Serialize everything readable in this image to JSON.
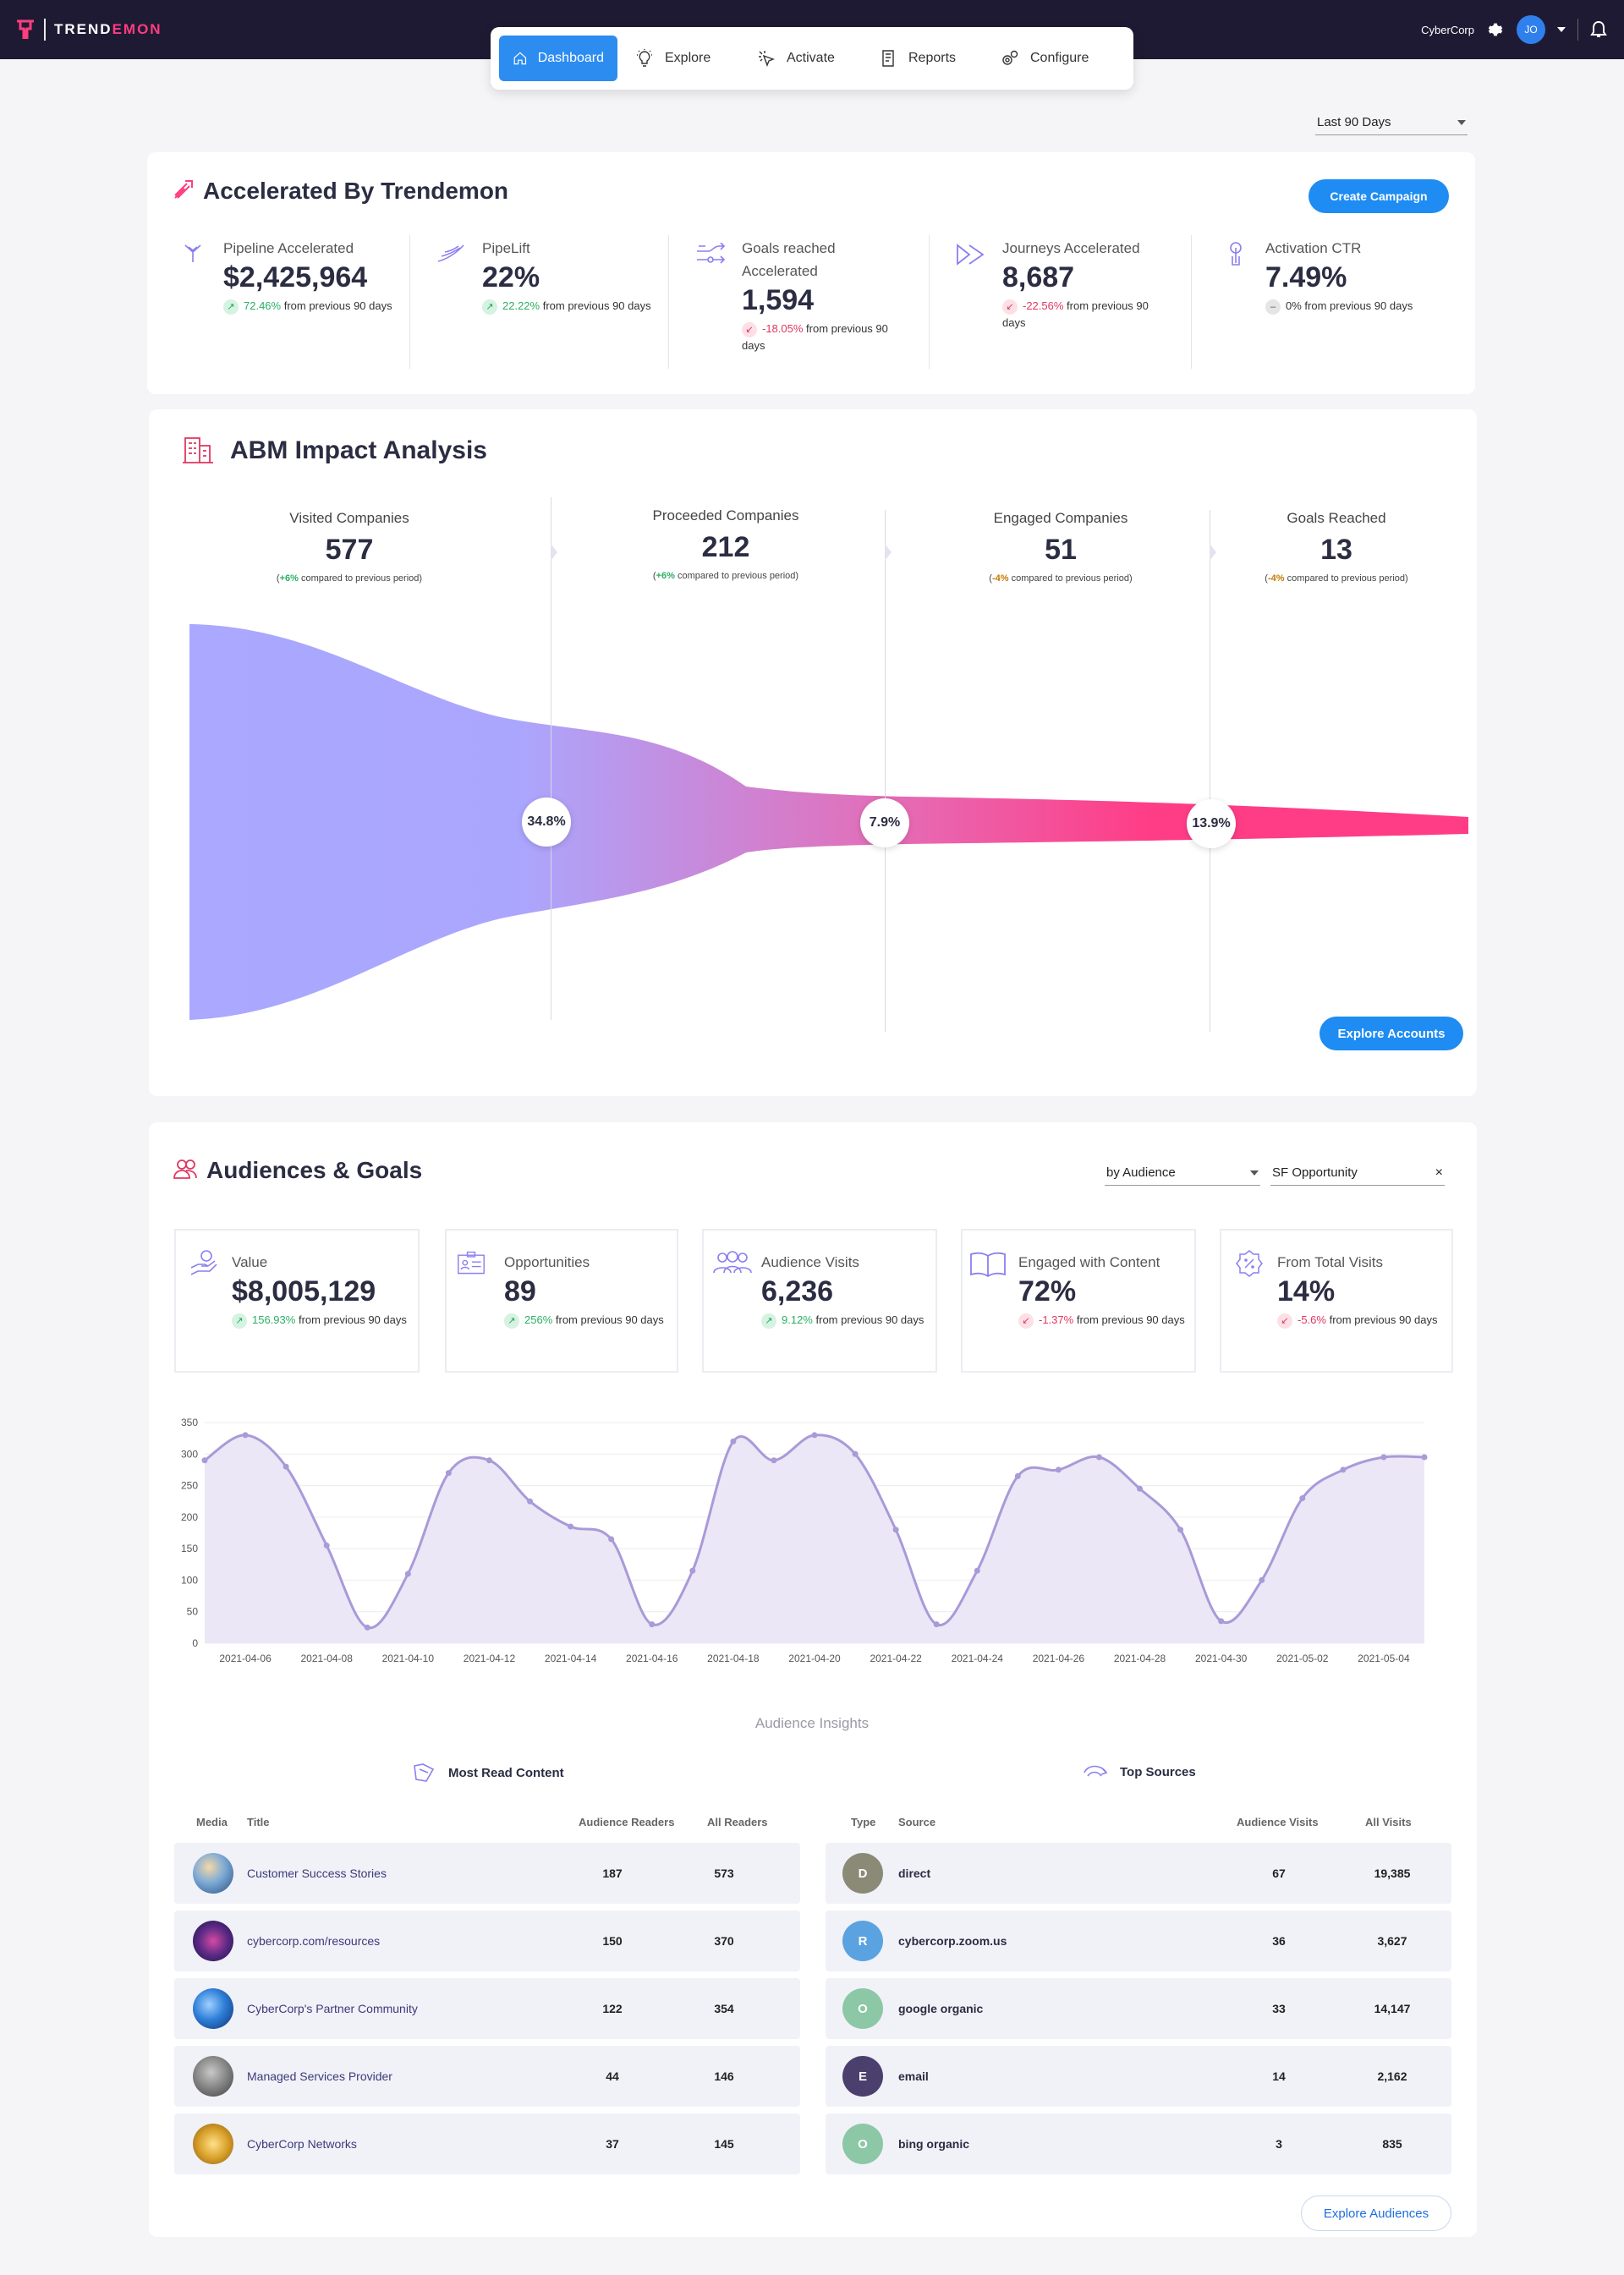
{
  "brand": {
    "name_part1": "TREND",
    "name_part2": "EMON"
  },
  "header": {
    "company": "CyberCorp",
    "avatar": "JO"
  },
  "nav": [
    {
      "label": "Dashboard",
      "icon": "home-icon",
      "active": true
    },
    {
      "label": "Explore",
      "icon": "lightbulb-icon"
    },
    {
      "label": "Activate",
      "icon": "cursor-click-icon"
    },
    {
      "label": "Reports",
      "icon": "report-icon"
    },
    {
      "label": "Configure",
      "icon": "gears-icon"
    }
  ],
  "date_range": "Last 90 Days",
  "accelerated": {
    "title": "Accelerated By Trendemon",
    "create_button": "Create Campaign",
    "kpis": [
      {
        "label": "Pipeline Accelerated",
        "value": "$2,425,964",
        "change": "72.46%",
        "trend": "up",
        "suffix": "from previous 90 days"
      },
      {
        "label": "PipeLift",
        "value": "22%",
        "change": "22.22%",
        "trend": "up",
        "suffix": "from previous 90 days"
      },
      {
        "label": "Goals reached Accelerated",
        "value": "1,594",
        "change": "-18.05%",
        "trend": "down",
        "suffix": "from previous 90 days"
      },
      {
        "label": "Journeys Accelerated",
        "value": "8,687",
        "change": "-22.56%",
        "trend": "down",
        "suffix": "from previous 90 days"
      },
      {
        "label": "Activation CTR",
        "value": "7.49%",
        "change": "0%",
        "trend": "flat",
        "suffix": "from previous 90 days"
      }
    ]
  },
  "abm": {
    "title": "ABM Impact Analysis",
    "stages": [
      {
        "label": "Visited Companies",
        "value": "577",
        "delta": "+6%",
        "note": "compared to previous period",
        "trend": "up"
      },
      {
        "label": "Proceeded Companies",
        "value": "212",
        "delta": "+6%",
        "note": "compared to previous period",
        "trend": "up"
      },
      {
        "label": "Engaged Companies",
        "value": "51",
        "delta": "-4%",
        "note": "compared to previous period",
        "trend": "down"
      },
      {
        "label": "Goals Reached",
        "value": "13",
        "delta": "-4%",
        "note": "compared to previous period",
        "trend": "down"
      }
    ],
    "conversion_rates": [
      "34.8%",
      "7.9%",
      "13.9%"
    ],
    "explore_button": "Explore Accounts",
    "colors": {
      "start": "#a9a6ff",
      "end": "#ff3d86"
    }
  },
  "audiences": {
    "title": "Audiences & Goals",
    "filter_audience": "by Audience",
    "filter_goal": "SF Opportunity",
    "kpis": [
      {
        "label": "Value",
        "value": "$8,005,129",
        "change": "156.93%",
        "trend": "up",
        "suffix": "from previous 90 days",
        "icon": "hand-dollar-icon"
      },
      {
        "label": "Opportunities",
        "value": "89",
        "change": "256%",
        "trend": "up",
        "suffix": "from previous 90 days",
        "icon": "id-card-icon"
      },
      {
        "label": "Audience Visits",
        "value": "6,236",
        "change": "9.12%",
        "trend": "up",
        "suffix": "from previous 90 days",
        "icon": "people-group-icon"
      },
      {
        "label": "Engaged with Content",
        "value": "72%",
        "change": "-1.37%",
        "trend": "down",
        "suffix": "from previous 90 days",
        "icon": "open-book-icon"
      },
      {
        "label": "From Total Visits",
        "value": "14%",
        "change": "-5.6%",
        "trend": "down",
        "suffix": "from previous 90 days",
        "icon": "percent-badge-icon"
      }
    ],
    "insights_title": "Audience Insights",
    "most_read": {
      "title": "Most Read Content",
      "columns": [
        "Media",
        "Title",
        "Audience Readers",
        "All Readers"
      ],
      "rows": [
        {
          "title": "Customer Success Stories",
          "audience": "187",
          "all": "573"
        },
        {
          "title": "cybercorp.com/resources",
          "audience": "150",
          "all": "370"
        },
        {
          "title": "CyberCorp's Partner Community",
          "audience": "122",
          "all": "354"
        },
        {
          "title": "Managed Services Provider",
          "audience": "44",
          "all": "146"
        },
        {
          "title": "CyberCorp Networks",
          "audience": "37",
          "all": "145"
        }
      ]
    },
    "top_sources": {
      "title": "Top Sources",
      "columns": [
        "Type",
        "Source",
        "Audience Visits",
        "All Visits"
      ],
      "rows": [
        {
          "type": "D",
          "source": "direct",
          "audience": "67",
          "all": "19,385",
          "color": "#8a8a76"
        },
        {
          "type": "R",
          "source": "cybercorp.zoom.us",
          "audience": "36",
          "all": "3,627",
          "color": "#5aa3e0"
        },
        {
          "type": "O",
          "source": "google organic",
          "audience": "33",
          "all": "14,147",
          "color": "#8cc7a6"
        },
        {
          "type": "E",
          "source": "email",
          "audience": "14",
          "all": "2,162",
          "color": "#4b3f6e"
        },
        {
          "type": "O",
          "source": "bing organic",
          "audience": "3",
          "all": "835",
          "color": "#8cc7a6"
        }
      ]
    },
    "explore_button": "Explore Audiences"
  },
  "chart_data": {
    "type": "area",
    "x": [
      "2021-04-05",
      "2021-04-06",
      "2021-04-07",
      "2021-04-08",
      "2021-04-09",
      "2021-04-10",
      "2021-04-11",
      "2021-04-12",
      "2021-04-13",
      "2021-04-14",
      "2021-04-15",
      "2021-04-16",
      "2021-04-17",
      "2021-04-18",
      "2021-04-19",
      "2021-04-20",
      "2021-04-21",
      "2021-04-22",
      "2021-04-23",
      "2021-04-24",
      "2021-04-25",
      "2021-04-26",
      "2021-04-27",
      "2021-04-28",
      "2021-04-29",
      "2021-04-30",
      "2021-05-01",
      "2021-05-02",
      "2021-05-03",
      "2021-05-04",
      "2021-05-05"
    ],
    "values": [
      290,
      330,
      280,
      155,
      25,
      110,
      270,
      290,
      225,
      185,
      165,
      30,
      115,
      320,
      290,
      330,
      300,
      180,
      30,
      115,
      265,
      275,
      295,
      245,
      180,
      35,
      100,
      230,
      275,
      295,
      295
    ],
    "xticks": [
      "2021-04-06",
      "2021-04-08",
      "2021-04-10",
      "2021-04-12",
      "2021-04-14",
      "2021-04-16",
      "2021-04-18",
      "2021-04-20",
      "2021-04-22",
      "2021-04-24",
      "2021-04-26",
      "2021-04-28",
      "2021-04-30",
      "2021-05-02",
      "2021-05-04"
    ],
    "yticks": [
      0,
      50,
      100,
      150,
      200,
      250,
      300,
      350
    ],
    "ylim": [
      0,
      350
    ],
    "grid": true,
    "color": "#a99ad8",
    "fill": "#ebe7f6"
  }
}
